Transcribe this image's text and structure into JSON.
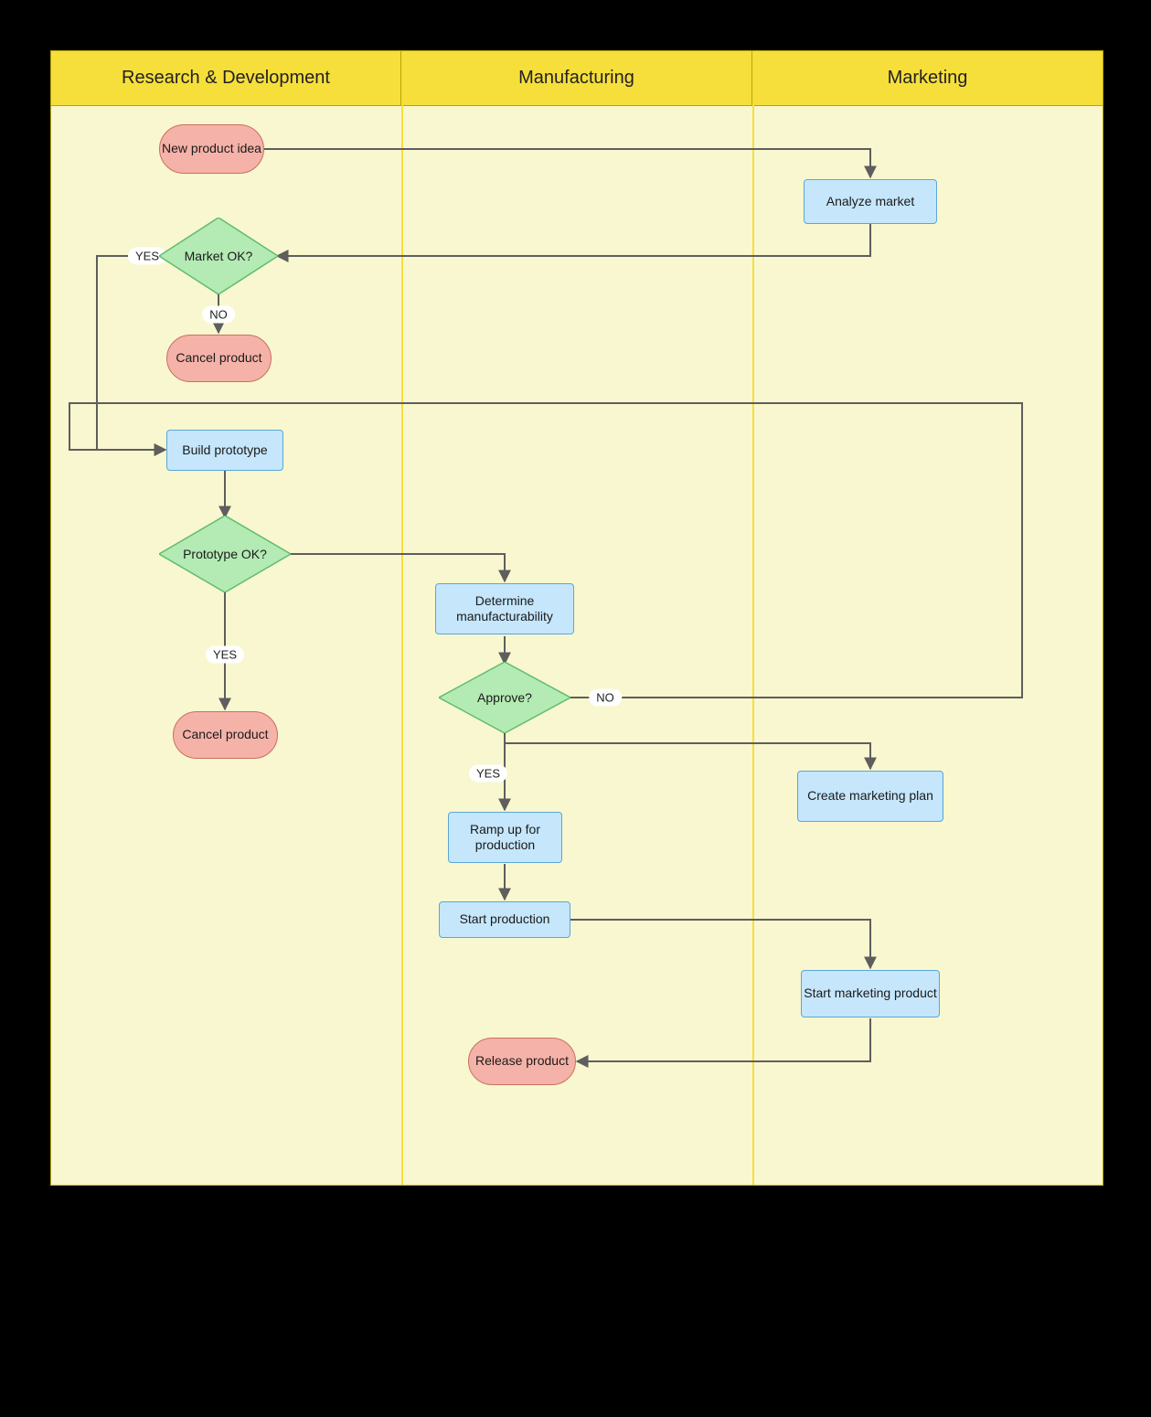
{
  "lanes": [
    {
      "title": "Research & Development"
    },
    {
      "title": "Manufacturing"
    },
    {
      "title": "Marketing"
    }
  ],
  "nodes": {
    "new_product_idea": {
      "label": "New product idea"
    },
    "analyze_market": {
      "label": "Analyze market"
    },
    "market_ok": {
      "label": "Market OK?"
    },
    "cancel_product_1": {
      "label": "Cancel product"
    },
    "build_prototype": {
      "label": "Build prototype"
    },
    "prototype_ok": {
      "label": "Prototype OK?"
    },
    "cancel_product_2": {
      "label": "Cancel product"
    },
    "determine_mfg": {
      "label": "Determine manufacturability"
    },
    "approve": {
      "label": "Approve?"
    },
    "create_marketing_plan": {
      "label": "Create marketing plan"
    },
    "ramp_up": {
      "label": "Ramp up for production"
    },
    "start_production": {
      "label": "Start production"
    },
    "start_marketing": {
      "label": "Start marketing product"
    },
    "release_product": {
      "label": "Release product"
    }
  },
  "edge_labels": {
    "market_ok_yes": "YES",
    "market_ok_no": "NO",
    "prototype_ok_yes": "YES",
    "approve_yes": "YES",
    "approve_no": "NO"
  },
  "chart_data": {
    "type": "swimlane-flowchart",
    "lanes": [
      "Research & Development",
      "Manufacturing",
      "Marketing"
    ],
    "nodes": [
      {
        "id": "new_product_idea",
        "type": "terminator",
        "lane": "Research & Development",
        "label": "New product idea"
      },
      {
        "id": "analyze_market",
        "type": "process",
        "lane": "Marketing",
        "label": "Analyze market"
      },
      {
        "id": "market_ok",
        "type": "decision",
        "lane": "Research & Development",
        "label": "Market OK?"
      },
      {
        "id": "cancel_product_1",
        "type": "terminator",
        "lane": "Research & Development",
        "label": "Cancel product"
      },
      {
        "id": "build_prototype",
        "type": "process",
        "lane": "Research & Development",
        "label": "Build prototype"
      },
      {
        "id": "prototype_ok",
        "type": "decision",
        "lane": "Research & Development",
        "label": "Prototype OK?"
      },
      {
        "id": "cancel_product_2",
        "type": "terminator",
        "lane": "Research & Development",
        "label": "Cancel product"
      },
      {
        "id": "determine_mfg",
        "type": "process",
        "lane": "Manufacturing",
        "label": "Determine manufacturability"
      },
      {
        "id": "approve",
        "type": "decision",
        "lane": "Manufacturing",
        "label": "Approve?"
      },
      {
        "id": "create_marketing_plan",
        "type": "process",
        "lane": "Marketing",
        "label": "Create marketing plan"
      },
      {
        "id": "ramp_up",
        "type": "process",
        "lane": "Manufacturing",
        "label": "Ramp up for production"
      },
      {
        "id": "start_production",
        "type": "process",
        "lane": "Manufacturing",
        "label": "Start production"
      },
      {
        "id": "start_marketing",
        "type": "process",
        "lane": "Marketing",
        "label": "Start marketing product"
      },
      {
        "id": "release_product",
        "type": "terminator",
        "lane": "Manufacturing",
        "label": "Release product"
      }
    ],
    "edges": [
      {
        "from": "new_product_idea",
        "to": "analyze_market"
      },
      {
        "from": "analyze_market",
        "to": "market_ok"
      },
      {
        "from": "market_ok",
        "to": "build_prototype",
        "label": "YES"
      },
      {
        "from": "market_ok",
        "to": "cancel_product_1",
        "label": "NO"
      },
      {
        "from": "build_prototype",
        "to": "prototype_ok"
      },
      {
        "from": "prototype_ok",
        "to": "determine_mfg"
      },
      {
        "from": "prototype_ok",
        "to": "cancel_product_2",
        "label": "YES"
      },
      {
        "from": "determine_mfg",
        "to": "approve"
      },
      {
        "from": "approve",
        "to": "ramp_up",
        "label": "YES"
      },
      {
        "from": "approve",
        "to": "build_prototype",
        "label": "NO"
      },
      {
        "from": "approve",
        "to": "create_marketing_plan"
      },
      {
        "from": "ramp_up",
        "to": "start_production"
      },
      {
        "from": "start_production",
        "to": "start_marketing"
      },
      {
        "from": "start_marketing",
        "to": "release_product"
      }
    ]
  }
}
